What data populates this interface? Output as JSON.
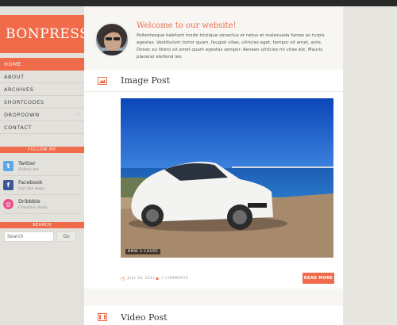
{
  "site": {
    "logo": "BONPRESS"
  },
  "nav": {
    "items": [
      {
        "label": "HOME",
        "active": true
      },
      {
        "label": "ABOUT"
      },
      {
        "label": "ARCHIVES"
      },
      {
        "label": "SHORTCODES"
      },
      {
        "label": "DROPDOWN",
        "has_children": true
      },
      {
        "label": "CONTACT"
      }
    ]
  },
  "follow": {
    "title": "FOLLOW ME",
    "items": [
      {
        "name": "Twitter",
        "sub": "Follow me",
        "icon": "twitter-icon",
        "color": "#5aa9e6"
      },
      {
        "name": "Facebook",
        "sub": "Our fan page",
        "icon": "facebook-icon",
        "color": "#3b5998"
      },
      {
        "name": "Dribbble",
        "sub": "Creative shots",
        "icon": "dribbble-icon",
        "color": "#ea4c89"
      }
    ]
  },
  "search": {
    "title": "SEARCH",
    "placeholder": "Search",
    "button": "Go"
  },
  "welcome": {
    "title": "Welcome to our website!",
    "text": "Pellentesque habitant morbi tristique senectus et netus et malesuada fames ac turpis egestas. Vestibulum tortor quam, feugiat vitae, ultricies eget, tempor sit amet, ante. Donec eu libero sit amet quam egestas semper. Aenean ultricies mi vitae est. Mauris placerat eleifend leo."
  },
  "posts": [
    {
      "title": "Image Post",
      "icon": "image-icon",
      "caption": "BMW 3 COUPE",
      "date": "JULY 18, 2011",
      "comments": "7 COMMENTS",
      "read_more": "READ MORE"
    },
    {
      "title": "Video Post",
      "icon": "video-icon"
    }
  ],
  "colors": {
    "accent": "#ef6b4a"
  }
}
